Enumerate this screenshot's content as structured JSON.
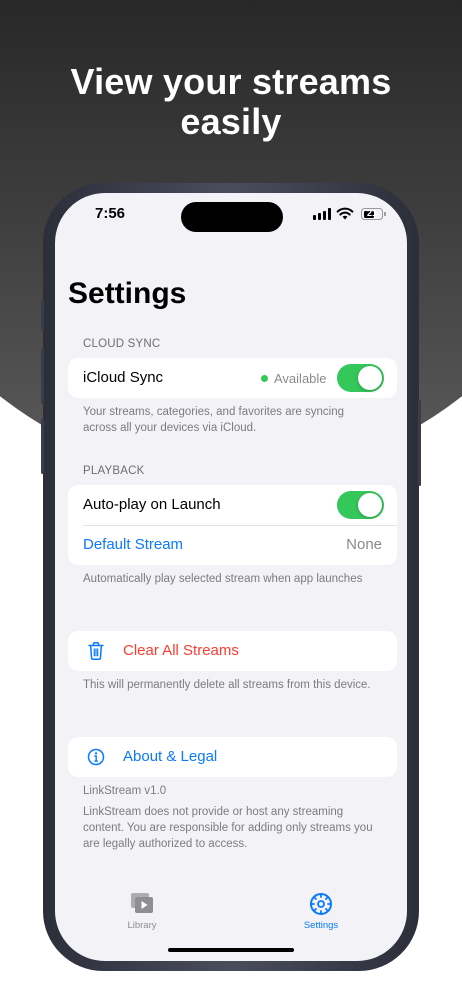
{
  "headline": "View your streams\neasily",
  "status_bar": {
    "time": "7:56",
    "battery": "21"
  },
  "title": "Settings",
  "cloud_sync": {
    "header": "CLOUD SYNC",
    "row_label": "iCloud Sync",
    "status": "Available",
    "toggle_on": true,
    "footer": "Your streams, categories, and favorites are syncing across all your devices via iCloud."
  },
  "playback": {
    "header": "PLAYBACK",
    "autoplay_label": "Auto-play on Launch",
    "autoplay_on": true,
    "default_stream_label": "Default Stream",
    "default_stream_value": "None",
    "footer": "Automatically play selected stream when app launches"
  },
  "clear": {
    "label": "Clear All Streams",
    "footer": "This will permanently delete all streams from this device."
  },
  "about": {
    "label": "About & Legal",
    "version": "LinkStream v1.0",
    "footer": "LinkStream does not provide or host any streaming content. You are responsible for adding only streams you are legally authorized to access."
  },
  "tabs": [
    {
      "label": "Library",
      "icon": "library-icon",
      "active": false
    },
    {
      "label": "Settings",
      "icon": "settings-gear-icon",
      "active": true
    }
  ],
  "colors": {
    "accent": "#0a7aff",
    "toggle_on": "#34c759",
    "danger": "#ff3b30",
    "inactive_tab": "#8e8e93"
  }
}
